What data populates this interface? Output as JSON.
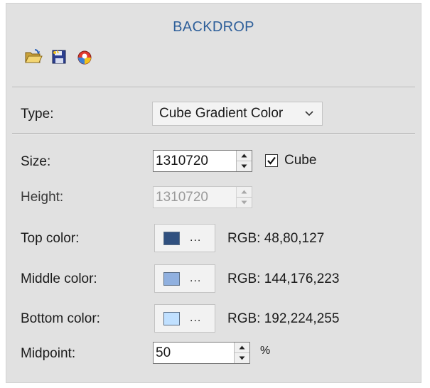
{
  "panel": {
    "title": "BACKDROP"
  },
  "toolbar": {
    "icons": [
      "open-folder-icon",
      "save-floppy-icon",
      "color-palette-icon"
    ]
  },
  "type": {
    "label": "Type:",
    "selected": "Cube Gradient Color"
  },
  "size": {
    "label": "Size:",
    "value": "1310720",
    "cube_label": "Cube",
    "cube_checked": true
  },
  "height": {
    "label": "Height:",
    "value": "1310720",
    "disabled": true
  },
  "top_color": {
    "label": "Top color:",
    "dots": "...",
    "rgb_text": "RGB: 48,80,127",
    "hex": "#30507f"
  },
  "middle_color": {
    "label": "Middle color:",
    "dots": "...",
    "rgb_text": "RGB: 144,176,223",
    "hex": "#90b0df"
  },
  "bottom_color": {
    "label": "Bottom color:",
    "dots": "...",
    "rgb_text": "RGB: 192,224,255",
    "hex": "#c0e0ff"
  },
  "midpoint": {
    "label": "Midpoint:",
    "value": "50",
    "unit": "%"
  },
  "colors": {
    "accent_title": "#2e5f9a",
    "panel_bg": "#e1e1e1"
  }
}
